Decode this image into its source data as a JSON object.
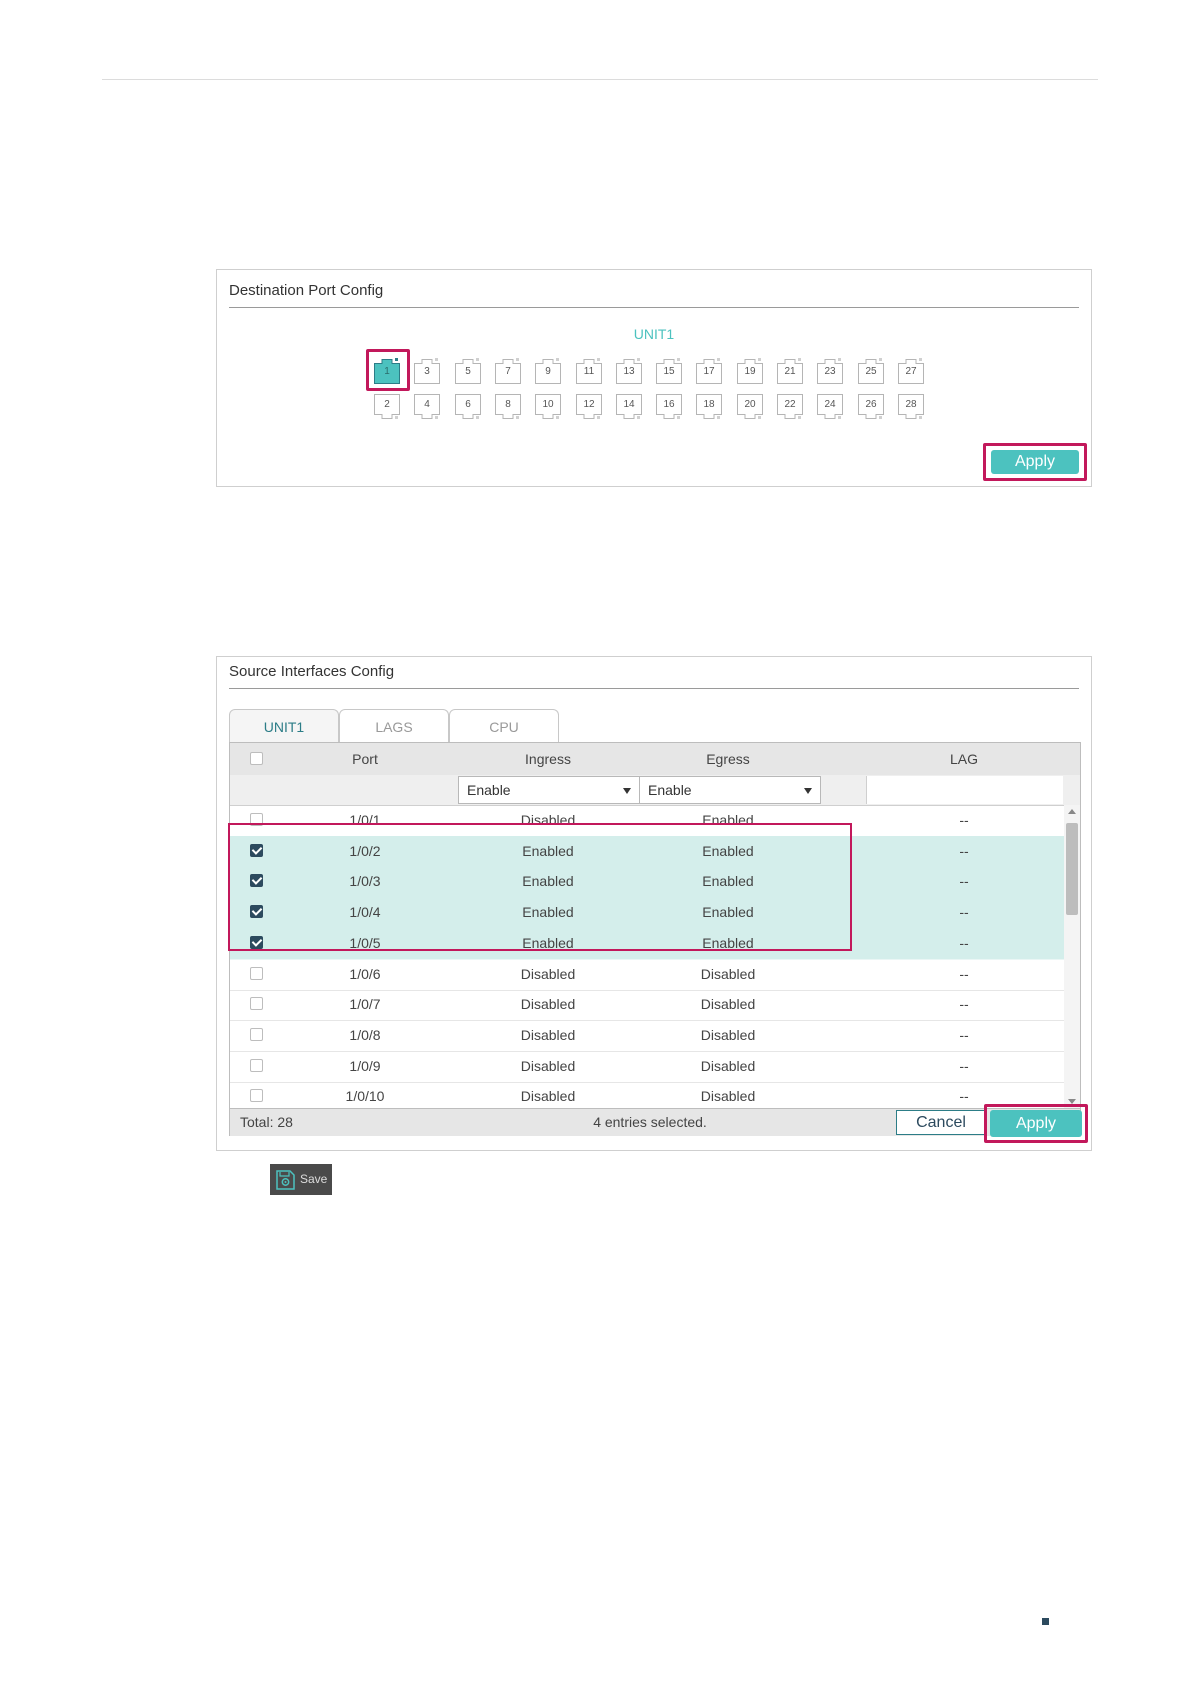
{
  "dest_panel": {
    "title": "Destination Port Config",
    "unit_label": "UNIT1",
    "top_ports": [
      "1",
      "3",
      "5",
      "7",
      "9",
      "11",
      "13",
      "15",
      "17",
      "19",
      "21",
      "23",
      "25",
      "27"
    ],
    "bottom_ports": [
      "2",
      "4",
      "6",
      "8",
      "10",
      "12",
      "14",
      "16",
      "18",
      "20",
      "22",
      "24",
      "26",
      "28"
    ],
    "selected_port": "1",
    "apply_label": "Apply"
  },
  "src_panel": {
    "title": "Source Interfaces Config",
    "tabs": [
      "UNIT1",
      "LAGS",
      "CPU"
    ],
    "active_tab": "UNIT1",
    "columns": {
      "port": "Port",
      "ingress": "Ingress",
      "egress": "Egress",
      "lag": "LAG"
    },
    "filter": {
      "ingress": "Enable",
      "egress": "Enable"
    },
    "rows": [
      {
        "port": "1/0/1",
        "ingress": "Disabled",
        "egress": "Enabled",
        "lag": "--",
        "checked": false
      },
      {
        "port": "1/0/2",
        "ingress": "Enabled",
        "egress": "Enabled",
        "lag": "--",
        "checked": true
      },
      {
        "port": "1/0/3",
        "ingress": "Enabled",
        "egress": "Enabled",
        "lag": "--",
        "checked": true
      },
      {
        "port": "1/0/4",
        "ingress": "Enabled",
        "egress": "Enabled",
        "lag": "--",
        "checked": true
      },
      {
        "port": "1/0/5",
        "ingress": "Enabled",
        "egress": "Enabled",
        "lag": "--",
        "checked": true
      },
      {
        "port": "1/0/6",
        "ingress": "Disabled",
        "egress": "Disabled",
        "lag": "--",
        "checked": false
      },
      {
        "port": "1/0/7",
        "ingress": "Disabled",
        "egress": "Disabled",
        "lag": "--",
        "checked": false
      },
      {
        "port": "1/0/8",
        "ingress": "Disabled",
        "egress": "Disabled",
        "lag": "--",
        "checked": false
      },
      {
        "port": "1/0/9",
        "ingress": "Disabled",
        "egress": "Disabled",
        "lag": "--",
        "checked": false
      },
      {
        "port": "1/0/10",
        "ingress": "Disabled",
        "egress": "Disabled",
        "lag": "--",
        "checked": false
      }
    ],
    "total": "Total: 28",
    "selected_info": "4 entries selected.",
    "cancel_label": "Cancel",
    "apply_label": "Apply"
  },
  "save": {
    "label": "Save",
    "icon": "save-gear-icon"
  },
  "colors": {
    "accent": "#4cc2bf",
    "highlight": "#c2185b",
    "selected_row": "#d4eeeb",
    "checkbox": "#2c4a5e"
  }
}
